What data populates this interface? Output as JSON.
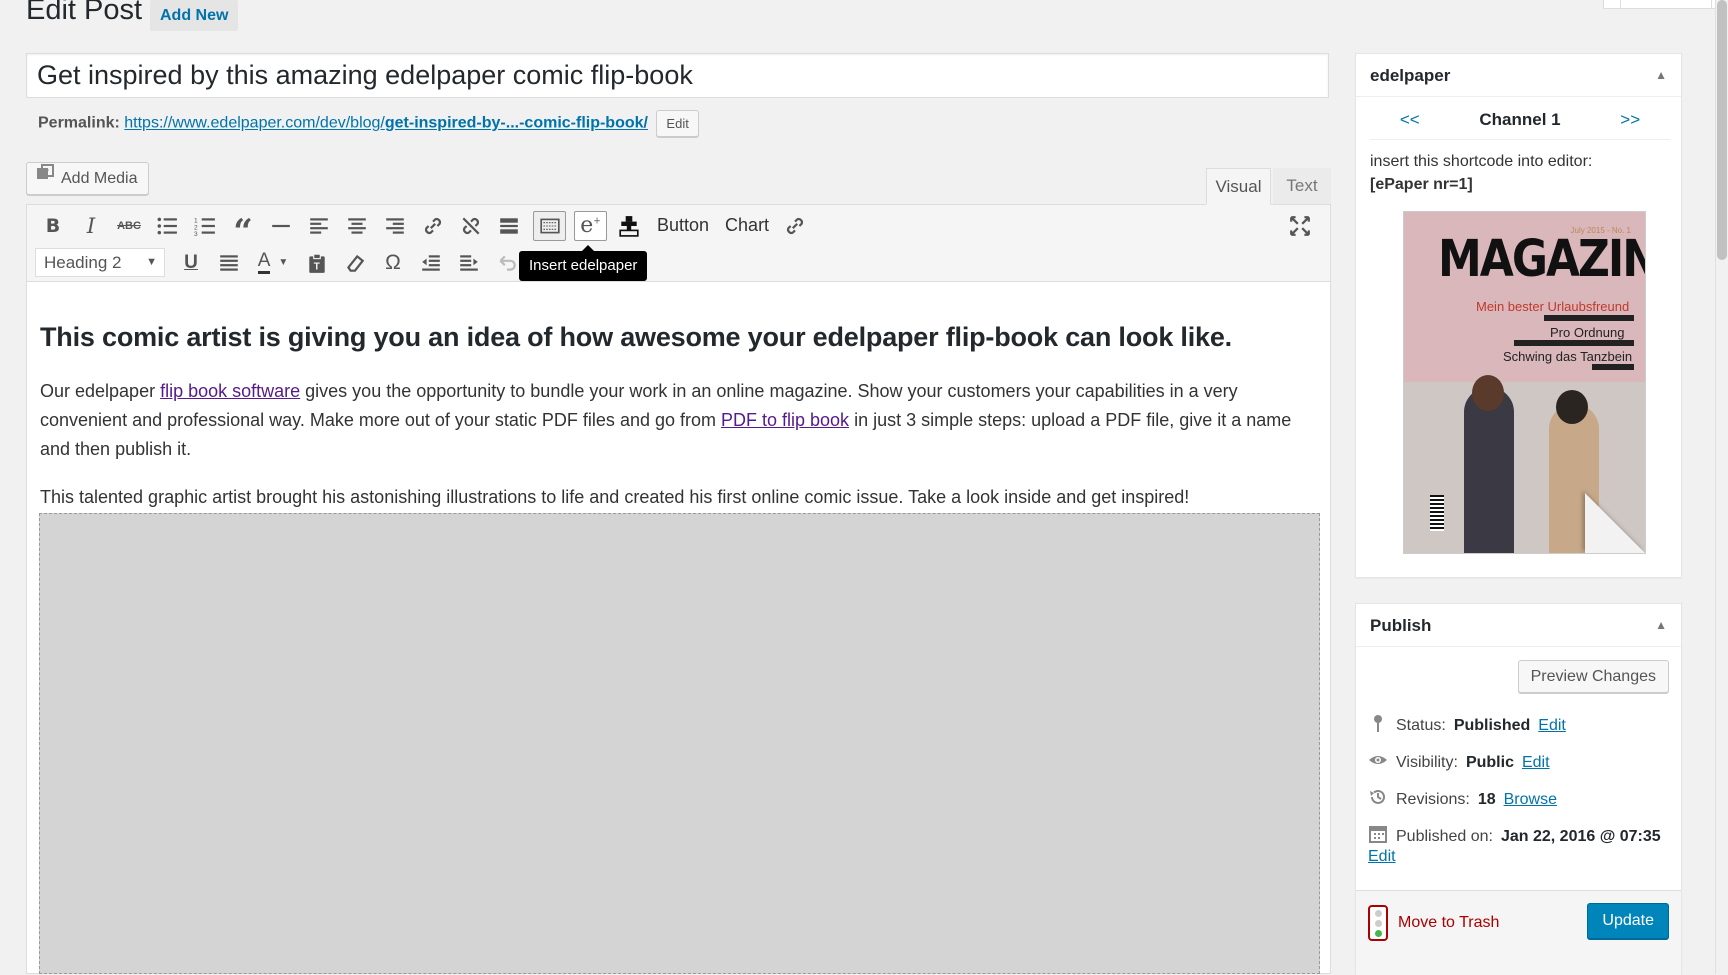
{
  "header": {
    "title": "Edit Post",
    "add_new": "Add New"
  },
  "post": {
    "title": "Get inspired by this amazing edelpaper comic flip-book",
    "permalink_label": "Permalink:",
    "permalink_base": "https://www.edelpaper.com/dev/blog/",
    "permalink_slug": "get-inspired-by-...-comic-flip-book/",
    "permalink_edit": "Edit"
  },
  "media": {
    "add_media": "Add Media"
  },
  "editor_tabs": {
    "visual": "Visual",
    "text": "Text"
  },
  "toolbar": {
    "button_label": "Button",
    "chart_label": "Chart",
    "format_select": "Heading 2",
    "tooltip": "Insert edelpaper",
    "icons": [
      "bold-icon",
      "italic-icon",
      "strikethrough-icon",
      "bullet-list-icon",
      "numbered-list-icon",
      "blockquote-icon",
      "horizontal-rule-icon",
      "align-left-icon",
      "align-center-icon",
      "align-right-icon",
      "link-icon",
      "unlink-icon",
      "read-more-icon",
      "toolbar-toggle-icon",
      "edelpaper-icon",
      "shortcode-icon",
      "link2-icon",
      "fullscreen-icon"
    ]
  },
  "content": {
    "heading": "This comic artist is giving you an idea of how awesome your edelpaper flip-book can look like.",
    "p1_a": "Our edelpaper ",
    "p1_link1": "flip book software",
    "p1_b": " gives you the opportunity to bundle your work in an online magazine. Show your customers your capabilities in a very convenient and professional way. Make more out of your static PDF files and go from ",
    "p1_link2": "PDF to flip book",
    "p1_c": " in just 3 simple steps: upload a PDF file, give it a name and then publish it.",
    "p2": "This talented graphic artist brought his astonishing illustrations to life and created his first online comic issue. Take a look inside and get inspired!"
  },
  "edelpaper_box": {
    "title": "edelpaper",
    "prev": "<<",
    "channel": "Channel 1",
    "next": ">>",
    "note": "insert this shortcode into editor:",
    "shortcode": "[ePaper nr=1]",
    "magazine": {
      "title": "MAGAZINE",
      "issue": "July 2015 - No. 1",
      "line1": "Mein bester Urlaubsfreund",
      "line2": "Pro Ordnung",
      "line3": "Schwing das Tanzbein"
    }
  },
  "publish_box": {
    "title": "Publish",
    "preview": "Preview Changes",
    "status_label": "Status:",
    "status_value": "Published",
    "visibility_label": "Visibility:",
    "visibility_value": "Public",
    "revisions_label": "Revisions:",
    "revisions_value": "18",
    "browse": "Browse",
    "published_label": "Published on:",
    "published_value": "Jan 22, 2016 @ 07:35",
    "edit": "Edit",
    "trash": "Move to Trash",
    "update": "Update"
  },
  "colors": {
    "accent": "#0073aa",
    "primary_button": "#0085ba",
    "trash": "#aa0000"
  }
}
